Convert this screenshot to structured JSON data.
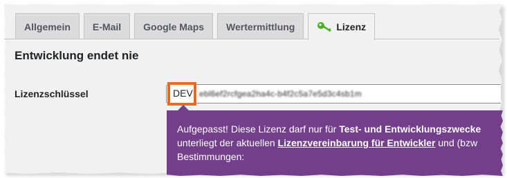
{
  "tabs": [
    {
      "label": "Allgemein",
      "active": false
    },
    {
      "label": "E-Mail",
      "active": false
    },
    {
      "label": "Google Maps",
      "active": false
    },
    {
      "label": "Wertermittlung",
      "active": false
    },
    {
      "label": "Lizenz",
      "active": true,
      "icon": "key-icon"
    }
  ],
  "section": {
    "title": "Entwicklung endet nie"
  },
  "license": {
    "label": "Lizenzschlüssel",
    "prefix": "DEV",
    "masked_value": "ebl6ef2rcfgea2ha4c-b4f2c5a7e5d3c4sb1m"
  },
  "notice": {
    "text_1": "Aufgepasst! Diese Lizenz darf nur für ",
    "text_1_strong": "Test- und Entwicklungszwecke",
    "text_2": "unterliegt der aktuellen ",
    "link": "Lizenzvereinbarung für Entwickler",
    "text_3": " und (bzw",
    "text_4": "Bestimmungen:"
  },
  "colors": {
    "accent_key": "#4caf2a",
    "highlight_border": "#e76a1e",
    "notice_bg": "#733f8a"
  }
}
